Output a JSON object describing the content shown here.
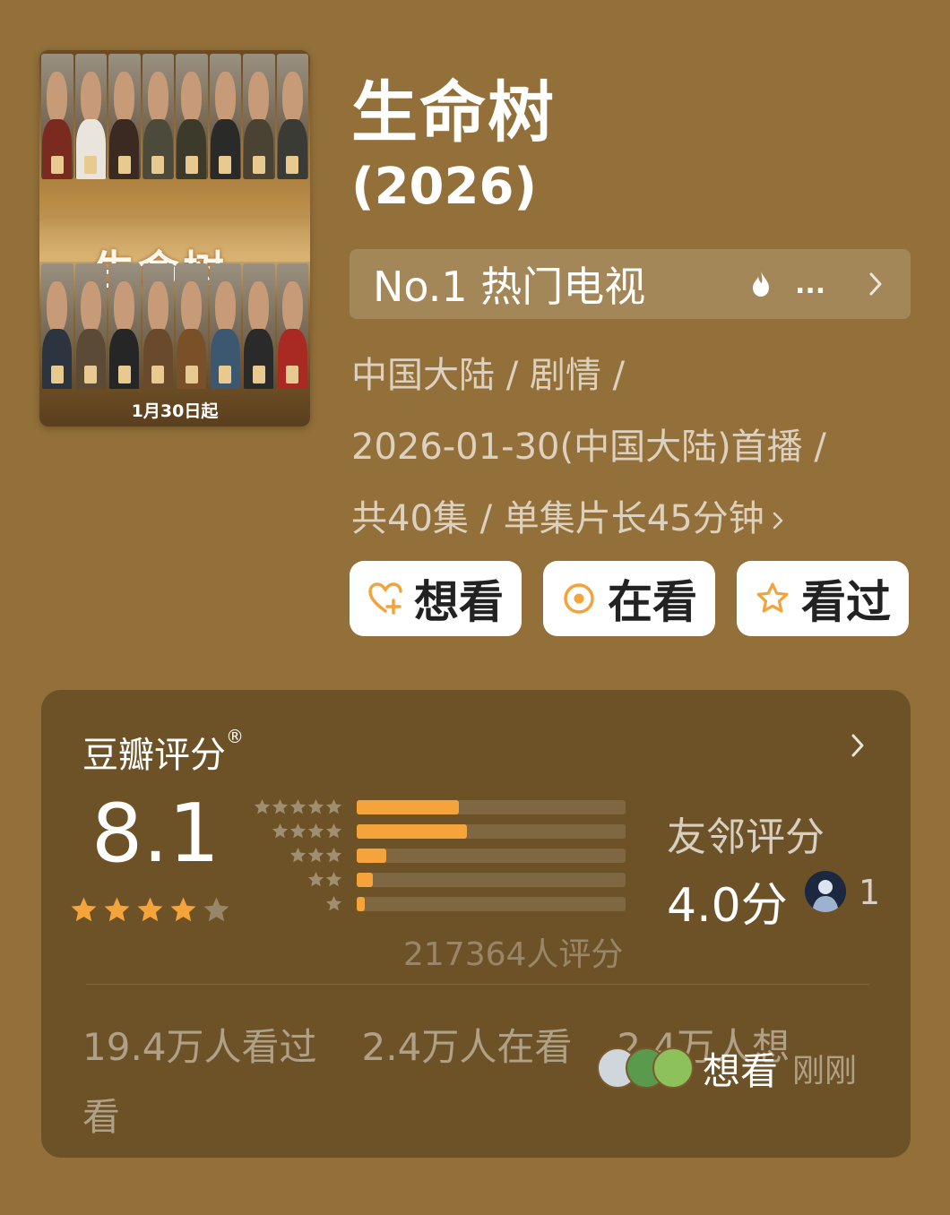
{
  "show": {
    "title": "生命树",
    "year": "(2026)",
    "poster": {
      "title_art": "生命树",
      "release_text": "1月30日起"
    }
  },
  "ranking": {
    "text": "No.1 热门电视",
    "icon": "fire-icon",
    "more": "..."
  },
  "meta": {
    "line1": "中国大陆 / 剧情 /",
    "line2": "2026-01-30(中国大陆)首播 /",
    "line3": "共40集 / 单集片长45分钟"
  },
  "actions": {
    "want": {
      "label": "想看",
      "icon": "heart-plus-icon"
    },
    "watching": {
      "label": "在看",
      "icon": "target-circle-icon"
    },
    "watched": {
      "label": "看过",
      "icon": "star-outline-icon"
    }
  },
  "rating": {
    "title": "豆瓣评分",
    "registered_mark": "®",
    "score": "8.1",
    "stars_filled": 4,
    "stars_total": 5,
    "distribution": [
      {
        "stars": 5,
        "fraction": 0.38
      },
      {
        "stars": 4,
        "fraction": 0.41
      },
      {
        "stars": 3,
        "fraction": 0.11
      },
      {
        "stars": 2,
        "fraction": 0.06
      },
      {
        "stars": 1,
        "fraction": 0.03
      }
    ],
    "total": "217364人评分",
    "friends": {
      "title": "友邻评分",
      "score": "4.0分",
      "count": "1"
    }
  },
  "stats": {
    "watched": "19.4万人看过",
    "watching": "2.4万人在看",
    "want": "2.4万人想看"
  },
  "activity": {
    "text": "想看",
    "time": "刚刚"
  },
  "colors": {
    "background": "#93703a",
    "accent_star": "#f4a43b",
    "button_icon": "#f2a33a"
  }
}
